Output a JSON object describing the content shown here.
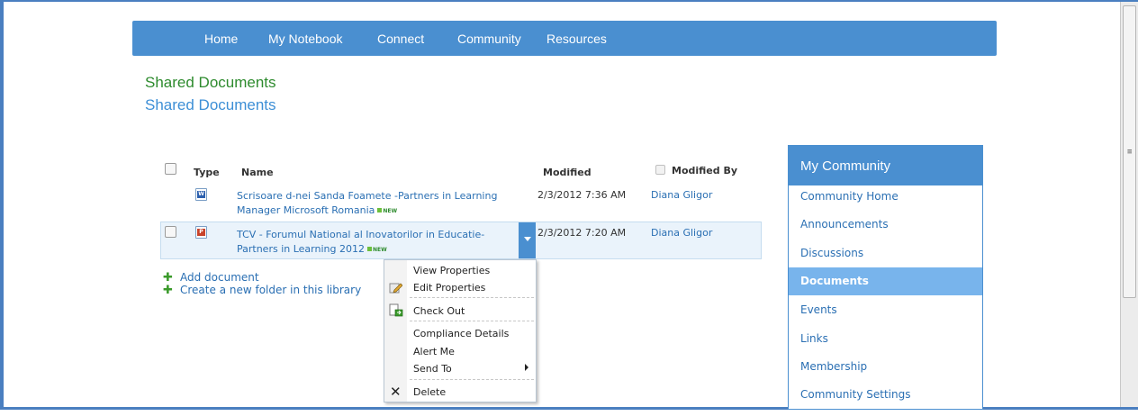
{
  "nav": {
    "items": [
      "Home",
      "My Notebook",
      "Connect",
      "Community",
      "Resources"
    ]
  },
  "page": {
    "title": "Shared Documents",
    "subtitle": "Shared Documents"
  },
  "list": {
    "columns": {
      "type": "Type",
      "name": "Name",
      "modified": "Modified",
      "modified_by": "Modified By"
    },
    "rows": [
      {
        "icon": "word-doc-icon",
        "name_line1": "Scrisoare d-nei Sanda Foamete -Partners in Learning",
        "name_line2": "Manager Microsoft Romania",
        "new_badge": "NEW",
        "modified": "2/3/2012 7:36 AM",
        "modified_by": "Diana Gligor"
      },
      {
        "icon": "powerpoint-doc-icon",
        "name_line1": "TCV - Forumul National al Inovatorilor in Educatie-",
        "name_line2": "Partners in Learning 2012",
        "new_badge": "NEW",
        "modified": "2/3/2012 7:20 AM",
        "modified_by": "Diana Gligor"
      }
    ]
  },
  "actions": {
    "add_document": "Add document",
    "new_folder": "Create a new folder in this library"
  },
  "context_menu": {
    "view_properties": "View Properties",
    "edit_properties": "Edit Properties",
    "check_out": "Check Out",
    "compliance_details": "Compliance Details",
    "alert_me": "Alert Me",
    "send_to": "Send To",
    "delete": "Delete"
  },
  "sidebar": {
    "title": "My Community",
    "items": [
      {
        "label": "Community Home",
        "active": false
      },
      {
        "label": "Announcements",
        "active": false
      },
      {
        "label": "Discussions",
        "active": false
      },
      {
        "label": "Documents",
        "active": true
      },
      {
        "label": "Events",
        "active": false
      },
      {
        "label": "Links",
        "active": false
      },
      {
        "label": "Membership",
        "active": false
      },
      {
        "label": "Community Settings",
        "active": false
      }
    ]
  },
  "colors": {
    "accent": "#4a8fd0",
    "title_green": "#2e8b2e",
    "link_blue": "#2a6fb3",
    "selected_item": "#78b4ec"
  }
}
